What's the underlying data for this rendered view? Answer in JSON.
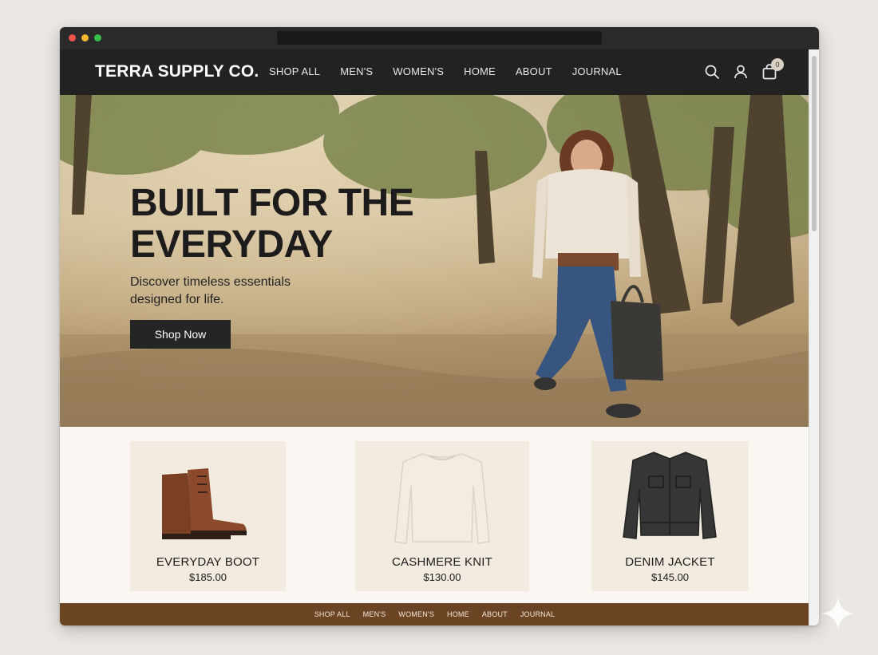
{
  "brand": {
    "logo_text": "TERRA SUPPLY CO.",
    "colors": {
      "header_bg": "#222222",
      "footer_bg": "#6b4423",
      "cta_bg": "#252525"
    }
  },
  "nav": {
    "items": [
      "SHOP ALL",
      "MEN'S",
      "WOMEN'S",
      "HOME",
      "ABOUT",
      "JOURNAL"
    ]
  },
  "header_icons": {
    "search": "search-icon",
    "account": "user-icon",
    "cart": "shopping-bag-icon",
    "cart_count": "0"
  },
  "hero": {
    "title_line1": "BUILT FOR THE",
    "title_line2": "EVERYDAY",
    "subtitle_line1": "Discover timeless essentials",
    "subtitle_line2": "designed for life.",
    "cta_label": "Shop Now"
  },
  "products": [
    {
      "name": "EVERYDAY BOOT",
      "price": "$185.00",
      "icon": "boot-image"
    },
    {
      "name": "CASHMERE KNIT",
      "price": "$130.00",
      "icon": "sweater-image"
    },
    {
      "name": "DENIM JACKET",
      "price": "$145.00",
      "icon": "jacket-image"
    }
  ],
  "footer": {
    "items": [
      "SHOP ALL",
      "MEN'S",
      "WOMEN'S",
      "HOME",
      "ABOUT",
      "JOURNAL"
    ]
  }
}
